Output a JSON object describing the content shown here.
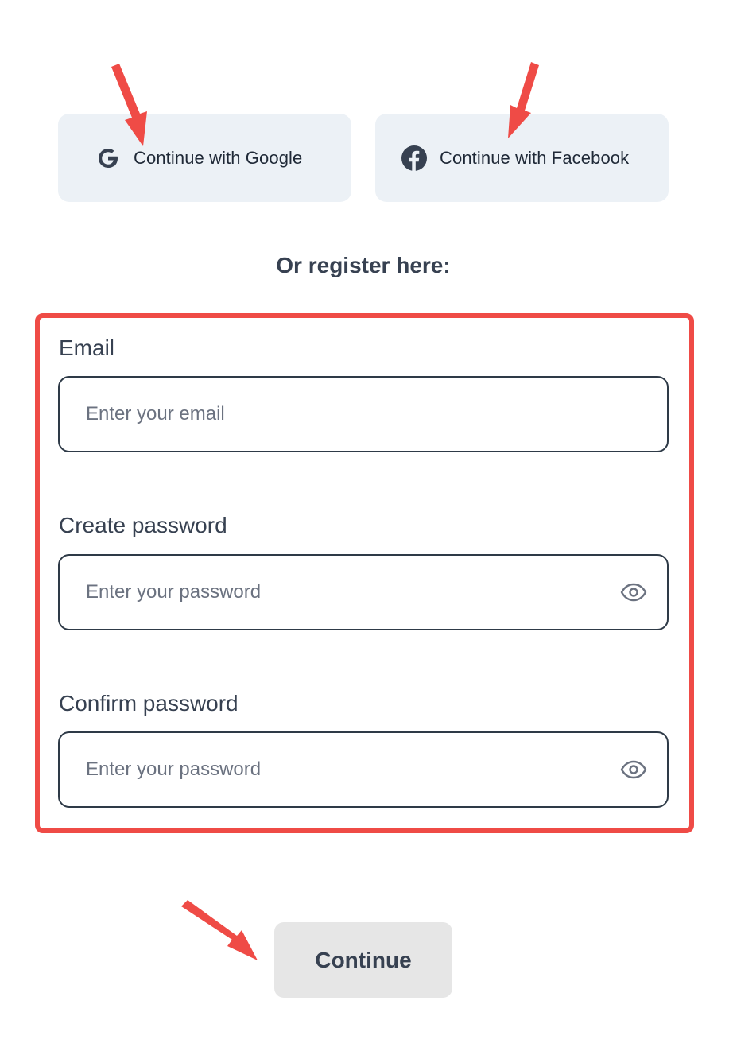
{
  "social": {
    "google_label": "Continue with Google",
    "facebook_label": "Continue with Facebook",
    "google_icon": "google-icon",
    "facebook_icon": "facebook-icon"
  },
  "divider_text": "Or register here:",
  "form": {
    "email": {
      "label": "Email",
      "placeholder": "Enter your email",
      "value": ""
    },
    "create_password": {
      "label": "Create password",
      "placeholder": "Enter your password",
      "value": "",
      "icon": "eye-icon"
    },
    "confirm_password": {
      "label": "Confirm password",
      "placeholder": "Enter your password",
      "value": "",
      "icon": "eye-icon"
    }
  },
  "continue_label": "Continue",
  "colors": {
    "highlight_border": "#ef4b46",
    "annotation_arrow": "#ef4b46",
    "social_button_bg": "#ecf1f6",
    "continue_button_bg": "#e6e6e6",
    "input_border": "#2e3a47"
  }
}
